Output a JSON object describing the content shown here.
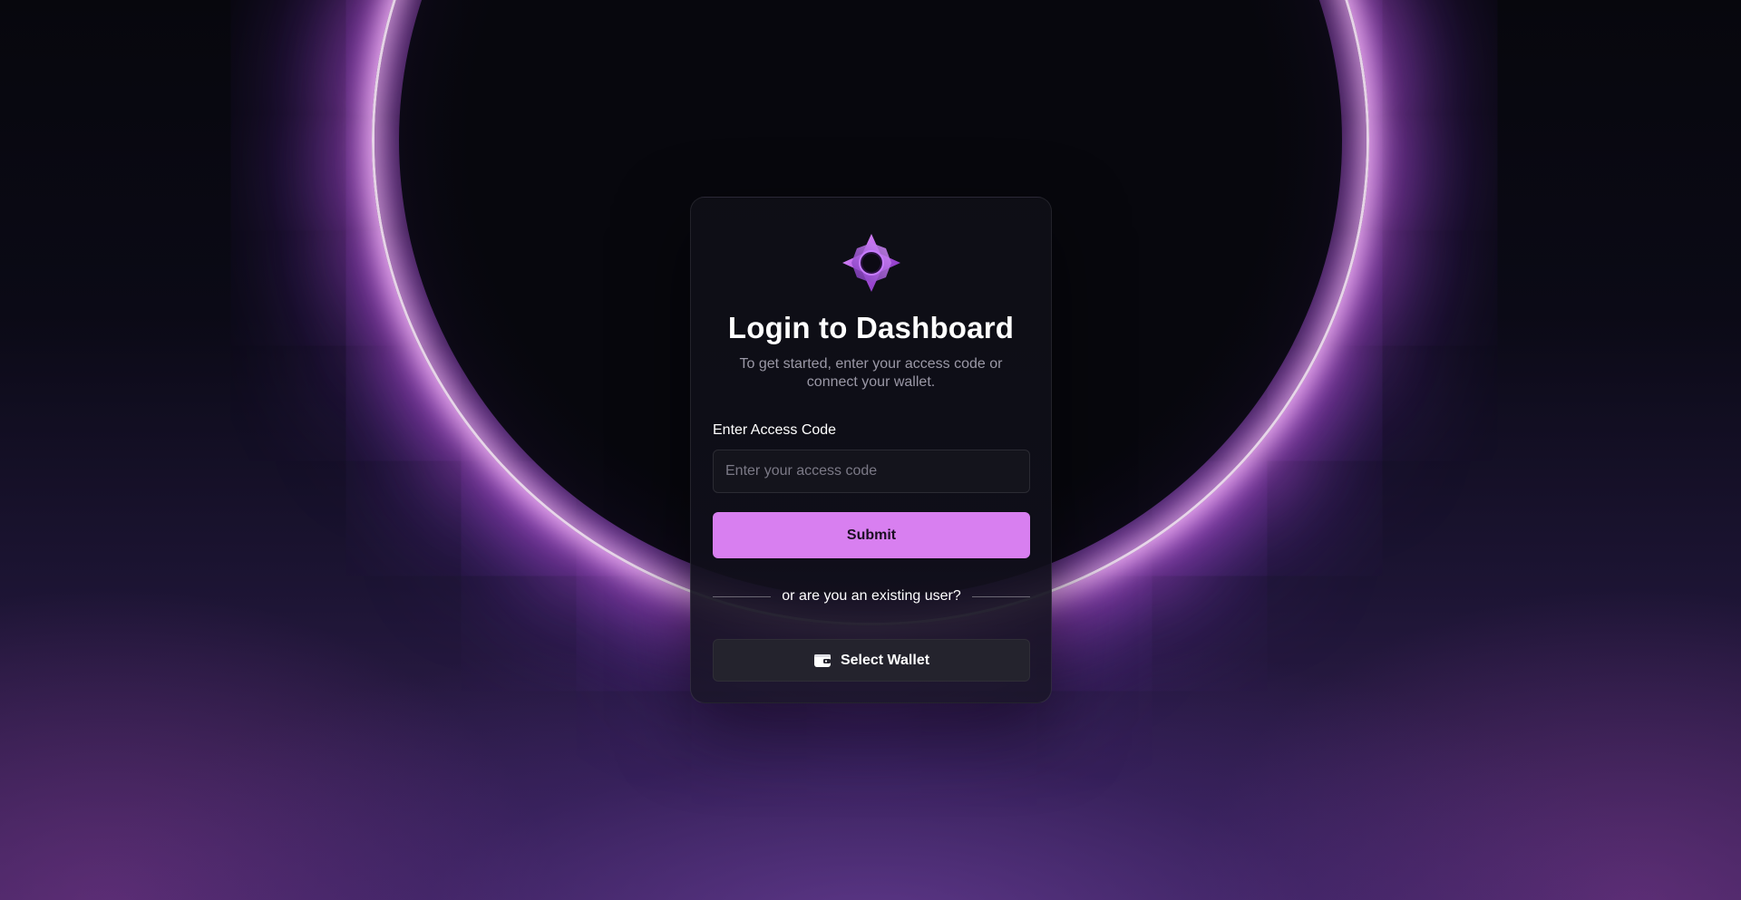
{
  "login": {
    "title": "Login to Dashboard",
    "subtitle": "To get started, enter your access code or connect your wallet.",
    "access_code_label": "Enter Access Code",
    "access_code_placeholder": "Enter your access code",
    "access_code_value": "",
    "submit_label": "Submit",
    "divider_text": "or are you an existing user?",
    "wallet_button_label": "Select Wallet"
  },
  "icons": {
    "logo": "star-logo-icon",
    "wallet": "wallet-icon"
  },
  "colors": {
    "accent": "#d87ff0",
    "card_background": "#0f0e17",
    "wallet_button": "#24232d",
    "ring_glow": "#d65cf0"
  }
}
